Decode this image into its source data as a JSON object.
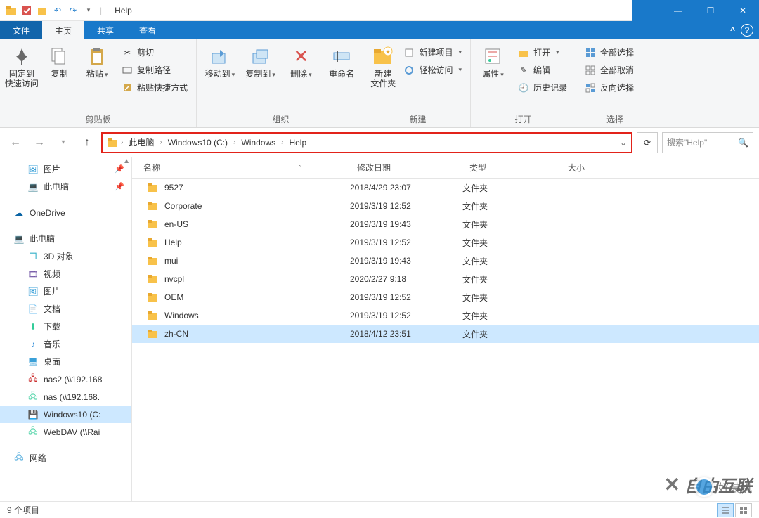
{
  "window": {
    "title": "Help",
    "minimize": "—",
    "maximize": "☐",
    "close": "✕"
  },
  "tabs": {
    "file": "文件",
    "home": "主页",
    "share": "共享",
    "view": "查看",
    "collapse": "^"
  },
  "ribbon": {
    "clipboard": {
      "label": "剪贴板",
      "pin": "固定到\n快速访问",
      "copy": "复制",
      "paste": "粘贴",
      "cut": "剪切",
      "copypath": "复制路径",
      "pasteshortcut": "粘贴快捷方式"
    },
    "organize": {
      "label": "组织",
      "moveto": "移动到",
      "copyto": "复制到",
      "delete": "删除",
      "rename": "重命名"
    },
    "new": {
      "label": "新建",
      "newfolder": "新建\n文件夹",
      "newitem": "新建项目",
      "easyaccess": "轻松访问"
    },
    "open": {
      "label": "打开",
      "properties": "属性",
      "open": "打开",
      "edit": "编辑",
      "history": "历史记录"
    },
    "select": {
      "label": "选择",
      "selectall": "全部选择",
      "selectnone": "全部取消",
      "invert": "反向选择"
    }
  },
  "breadcrumb": {
    "items": [
      "此电脑",
      "Windows10 (C:)",
      "Windows",
      "Help"
    ]
  },
  "search": {
    "placeholder": "搜索\"Help\""
  },
  "columns": {
    "name": "名称",
    "modified": "修改日期",
    "type": "类型",
    "size": "大小"
  },
  "sidebar": {
    "quick": {
      "pictures": "图片",
      "thispc": "此电脑"
    },
    "onedrive": "OneDrive",
    "thispc": "此电脑",
    "thispc_children": {
      "objects3d": "3D 对象",
      "videos": "视频",
      "pictures": "图片",
      "documents": "文档",
      "downloads": "下载",
      "music": "音乐",
      "desktop": "桌面",
      "nas2": "nas2 (\\\\192.168",
      "nas": "nas (\\\\192.168.",
      "win10c": "Windows10 (C:",
      "webdav": "WebDAV (\\\\Rai"
    },
    "network": "网络"
  },
  "files": [
    {
      "name": "9527",
      "date": "2018/4/29 23:07",
      "type": "文件夹",
      "selected": false
    },
    {
      "name": "Corporate",
      "date": "2019/3/19 12:52",
      "type": "文件夹",
      "selected": false
    },
    {
      "name": "en-US",
      "date": "2019/3/19 19:43",
      "type": "文件夹",
      "selected": false
    },
    {
      "name": "Help",
      "date": "2019/3/19 12:52",
      "type": "文件夹",
      "selected": false
    },
    {
      "name": "mui",
      "date": "2019/3/19 19:43",
      "type": "文件夹",
      "selected": false
    },
    {
      "name": "nvcpl",
      "date": "2020/2/27 9:18",
      "type": "文件夹",
      "selected": false
    },
    {
      "name": "OEM",
      "date": "2019/3/19 12:52",
      "type": "文件夹",
      "selected": false
    },
    {
      "name": "Windows",
      "date": "2019/3/19 12:52",
      "type": "文件夹",
      "selected": false
    },
    {
      "name": "zh-CN",
      "date": "2018/4/12 23:51",
      "type": "文件夹",
      "selected": true
    }
  ],
  "status": {
    "count": "9 个项目"
  },
  "watermark": {
    "text1": "自由互联",
    "text2": "好装机"
  }
}
